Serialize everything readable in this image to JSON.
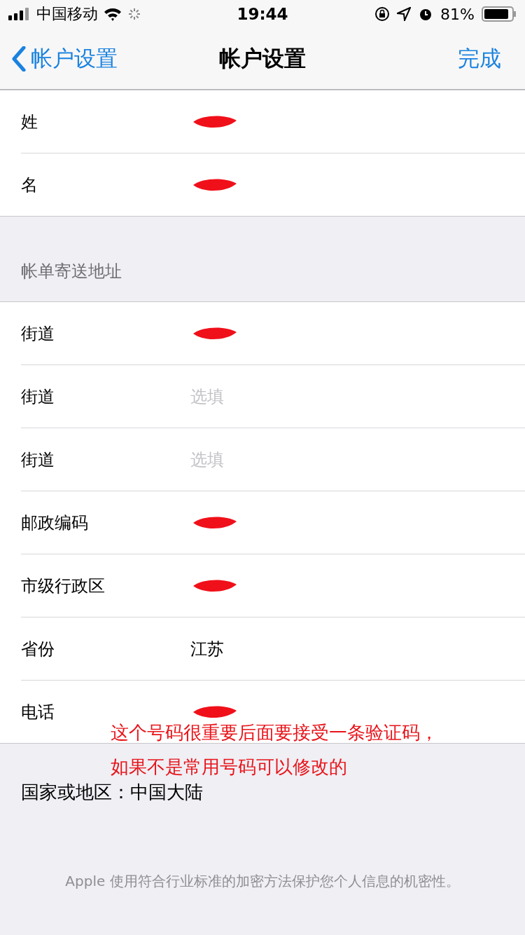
{
  "status_bar": {
    "carrier": "中国移动",
    "time": "19:44",
    "battery": "81%"
  },
  "nav": {
    "back": "帐户设置",
    "title": "帐户设置",
    "done": "完成"
  },
  "name_rows": [
    {
      "label": "姓",
      "kind": "redacted"
    },
    {
      "label": "名",
      "kind": "redacted"
    }
  ],
  "billing": {
    "header": "帐单寄送地址",
    "rows": [
      {
        "label": "街道",
        "kind": "redacted"
      },
      {
        "label": "街道",
        "kind": "placeholder",
        "placeholder": "选填"
      },
      {
        "label": "街道",
        "kind": "placeholder",
        "placeholder": "选填"
      },
      {
        "label": "邮政编码",
        "kind": "redacted"
      },
      {
        "label": "市级行政区",
        "kind": "redacted"
      },
      {
        "label": "省份",
        "kind": "value",
        "value": "江苏"
      },
      {
        "label": "电话",
        "kind": "redacted"
      }
    ]
  },
  "annotation": [
    "这个号码很重要后面要接受一条验证码，",
    "如果不是常用号码可以修改的"
  ],
  "country": "国家或地区：中国大陆",
  "footer": "Apple 使用符合行业标准的加密方法保护您个人信息的机密性。"
}
